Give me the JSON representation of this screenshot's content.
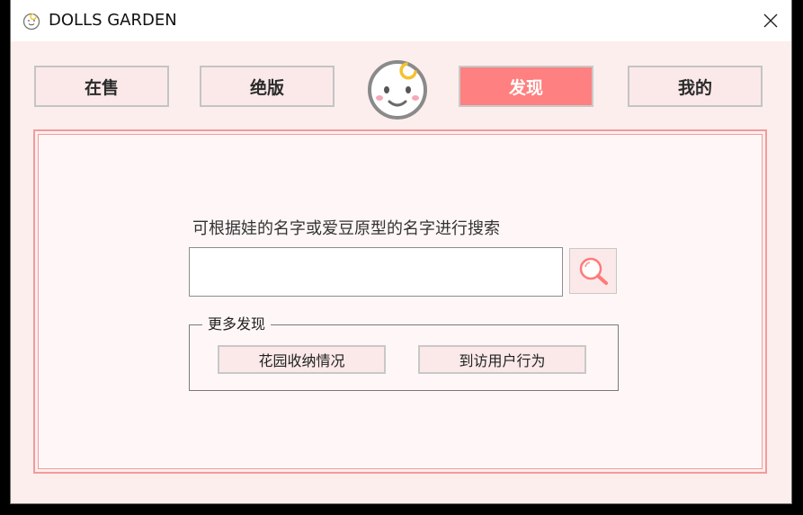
{
  "window": {
    "title": "DOLLS GARDEN",
    "close_icon": "close-icon",
    "app_icon": "baby-face-icon"
  },
  "nav": {
    "tabs": [
      {
        "label": "在售",
        "active": false
      },
      {
        "label": "绝版",
        "active": false
      },
      {
        "label": "发现",
        "active": true
      },
      {
        "label": "我的",
        "active": false
      }
    ],
    "logo_icon": "baby-face-icon"
  },
  "search": {
    "hint": "可根据娃的名字或爱豆原型的名字进行搜索",
    "value": "",
    "placeholder": "",
    "button_icon": "search-icon"
  },
  "more": {
    "legend": "更多发现",
    "buttons": [
      {
        "label": "花园收纳情况"
      },
      {
        "label": "到访用户行为"
      }
    ]
  },
  "colors": {
    "background": "#fdeeee",
    "accent": "#ff8080",
    "panel_border": "#f29b9b",
    "panel_fill": "#fff7f7",
    "logo_moon": "#f5c22e"
  }
}
